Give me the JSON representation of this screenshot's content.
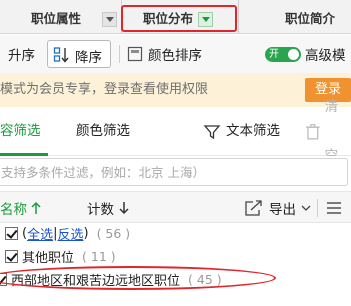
{
  "columns": {
    "col1": "职位属性",
    "col2": "职位分布",
    "col3": "职位简介"
  },
  "toolbar": {
    "asc": "升序",
    "desc": "降序",
    "color_sort": "颜色排序",
    "toggle_label": "开",
    "advanced": "高级模"
  },
  "banner": {
    "text": "模式为会员专享，登录查看使用权限",
    "login": "登录"
  },
  "tabs": {
    "content_filter": "容筛选",
    "color_filter": "颜色筛选",
    "text_filter": "文本筛选",
    "clear": "清空"
  },
  "search": {
    "placeholder": "支持多条件过滤，例如：北京 上海）"
  },
  "list_header": {
    "name": "名称",
    "count": "计数",
    "export": "导出"
  },
  "items": [
    {
      "select_all": "全选",
      "sep": "|",
      "invert": "反选",
      "count": "( 56 )",
      "checked": true
    },
    {
      "label": "其他职位",
      "count": "( 11 )",
      "checked": true
    },
    {
      "label": "西部地区和艰苦边远地区职位",
      "count": "( 45 )",
      "checked": true
    }
  ],
  "colors": {
    "accent_green": "#1e9a3e",
    "highlight_red": "#e0262b",
    "login_orange": "#f0922f",
    "link_blue": "#1a55c8"
  }
}
